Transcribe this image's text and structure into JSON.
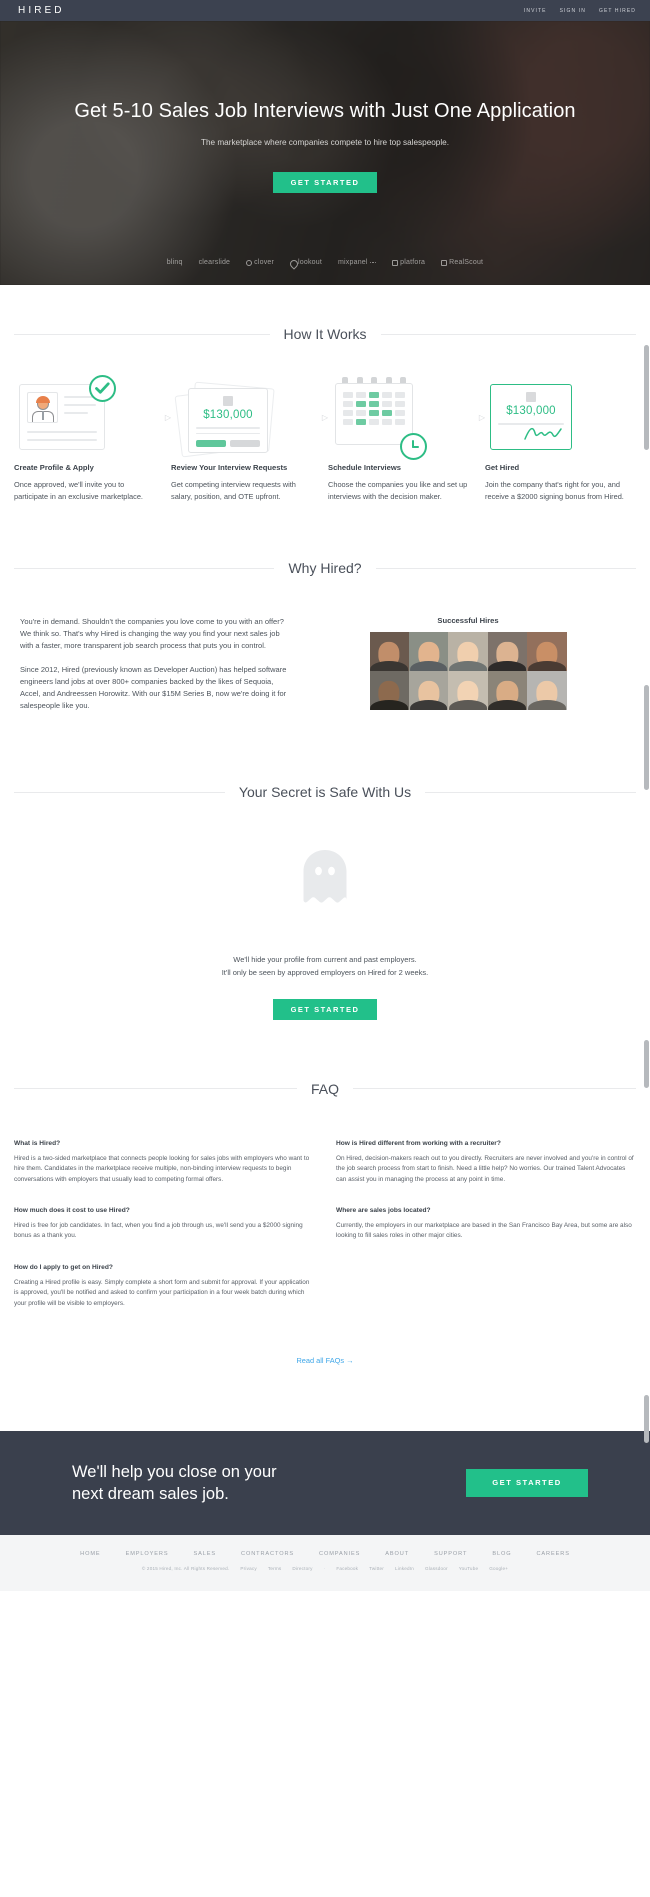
{
  "nav": {
    "brand": "HIRED",
    "links": [
      {
        "label": "INVITE"
      },
      {
        "label": "SIGN IN"
      },
      {
        "label": "GET HIRED"
      }
    ]
  },
  "hero": {
    "title": "Get 5-10 Sales Job Interviews with Just One Application",
    "subtitle": "The marketplace where companies compete to hire top salespeople.",
    "cta": "GET STARTED",
    "logos": [
      {
        "name": "blinq",
        "icon": "none"
      },
      {
        "name": "clearslide",
        "icon": "circle-overlap"
      },
      {
        "name": "clover",
        "icon": "clover-leaf"
      },
      {
        "name": "lookout",
        "icon": "shield"
      },
      {
        "name": "mixpanel",
        "icon": "dots"
      },
      {
        "name": "platfora",
        "icon": "square"
      },
      {
        "name": "RealScout",
        "icon": "house"
      }
    ]
  },
  "how_it_works": {
    "heading": "How It Works",
    "steps": [
      {
        "title": "Create Profile & Apply",
        "body": "Once approved, we'll invite you to participate in an exclusive marketplace.",
        "art": "profile-card-check"
      },
      {
        "title": "Review Your Interview Requests",
        "body": "Get competing interview requests with salary, position, and OTE upfront.",
        "art": "offer-stack",
        "amount": "$130,000"
      },
      {
        "title": "Schedule Interviews",
        "body": "Choose the companies you like and set up interviews with the decision maker.",
        "art": "calendar-clock"
      },
      {
        "title": "Get Hired",
        "body": "Join the company that's right for you, and receive a $2000 signing bonus from Hired.",
        "art": "signed-offer",
        "amount": "$130,000"
      }
    ]
  },
  "why_hired": {
    "heading": "Why Hired?",
    "paragraphs": [
      "You're in demand. Shouldn't the companies you love come to you with an offer? We think so. That's why Hired is changing the way you find your next sales job with a faster, more transparent job search process that puts you in control.",
      "Since 2012, Hired (previously known as Developer Auction) has helped software engineers land jobs at over 800+ companies backed by the likes of Sequoia, Accel, and Andreessen Horowitz. With our $15M Series B, now we're doing it for salespeople like you."
    ],
    "hires_title": "Successful Hires"
  },
  "secret": {
    "heading": "Your Secret is Safe With Us",
    "icon": "ghost-icon",
    "line1": "We'll hide your profile from current and past employers.",
    "line2": "It'll only be seen by approved employers on Hired for 2 weeks.",
    "cta": "GET STARTED"
  },
  "faq": {
    "heading": "FAQ",
    "left": [
      {
        "q": "What is Hired?",
        "a": "Hired is a two-sided marketplace that connects people looking for sales jobs with employers who want to hire them. Candidates in the marketplace receive multiple, non-binding interview requests to begin conversations with employers that usually lead to competing formal offers."
      },
      {
        "q": "How much does it cost to use Hired?",
        "a": "Hired is free for job candidates. In fact, when you find a job through us, we'll send you a $2000 signing bonus as a thank you."
      },
      {
        "q": "How do I apply to get on Hired?",
        "a": "Creating a Hired profile is easy. Simply complete a short form and submit for approval. If your application is approved, you'll be notified and asked to confirm your participation in a four week batch during which your profile will be visible to employers."
      }
    ],
    "right": [
      {
        "q": "How is Hired different from working with a recruiter?",
        "a": "On Hired, decision-makers reach out to you directly. Recruiters are never involved and you're in control of the job search process from start to finish. Need a little help? No worries. Our trained Talent Advocates can assist you in managing the process at any point in time."
      },
      {
        "q": "Where are sales jobs located?",
        "a": "Currently, the employers in our marketplace are based in the San Francisco Bay Area, but some are also looking to fill sales roles in other major cities."
      }
    ],
    "more_link": "Read all FAQs →"
  },
  "bottom_cta": {
    "headline_line1": "We'll help you close on your",
    "headline_line2": "next dream sales job.",
    "cta": "GET STARTED"
  },
  "footer": {
    "nav": [
      "HOME",
      "EMPLOYERS",
      "SALES",
      "CONTRACTORS",
      "COMPANIES",
      "ABOUT",
      "SUPPORT",
      "BLOG",
      "CAREERS"
    ],
    "copyright": "© 2015 Hired, Inc. All Rights Reserved.",
    "legal": [
      "Privacy",
      "Terms",
      "Directory"
    ],
    "separator": "·",
    "social": [
      "Facebook",
      "Twitter",
      "LinkedIn",
      "Glassdoor",
      "YouTube",
      "Google+"
    ]
  },
  "colors": {
    "accent_green": "#22c08a",
    "dark_navy": "#3a404d",
    "nav_dark": "#3c4250",
    "link_blue": "#3ea6e8"
  }
}
